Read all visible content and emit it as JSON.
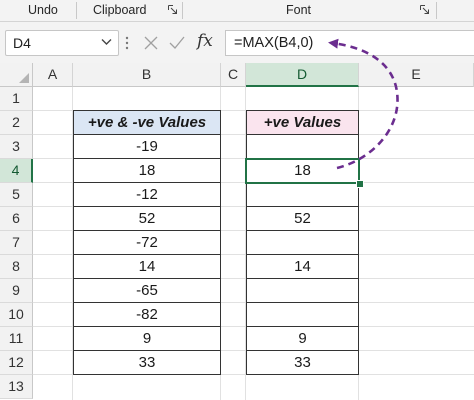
{
  "ribbon": {
    "groups": [
      "Undo",
      "Clipboard",
      "Font"
    ]
  },
  "formula_bar": {
    "name_box": "D4",
    "fx_label": "fx",
    "formula": "=MAX(B4,0)"
  },
  "columns": [
    "A",
    "B",
    "C",
    "D",
    "E"
  ],
  "selected_column": "D",
  "rows": [
    "1",
    "2",
    "3",
    "4",
    "5",
    "6",
    "7",
    "8",
    "9",
    "10",
    "11",
    "12",
    "13"
  ],
  "selected_row": "4",
  "table_b": {
    "header": "+ve & -ve Values",
    "values": [
      "-19",
      "18",
      "-12",
      "52",
      "-72",
      "14",
      "-65",
      "-82",
      "9",
      "33"
    ]
  },
  "table_d": {
    "header": "+ve Values",
    "values": [
      "",
      "18",
      "",
      "52",
      "",
      "14",
      "",
      "",
      "9",
      "33"
    ]
  },
  "colors": {
    "accent": "#217346",
    "header_b_fill": "#dbe6f4",
    "header_d_fill": "#fae4ee",
    "arrow": "#6b2d8f"
  },
  "annotation": {
    "arrow_from": "D4",
    "arrow_to": "formula"
  }
}
